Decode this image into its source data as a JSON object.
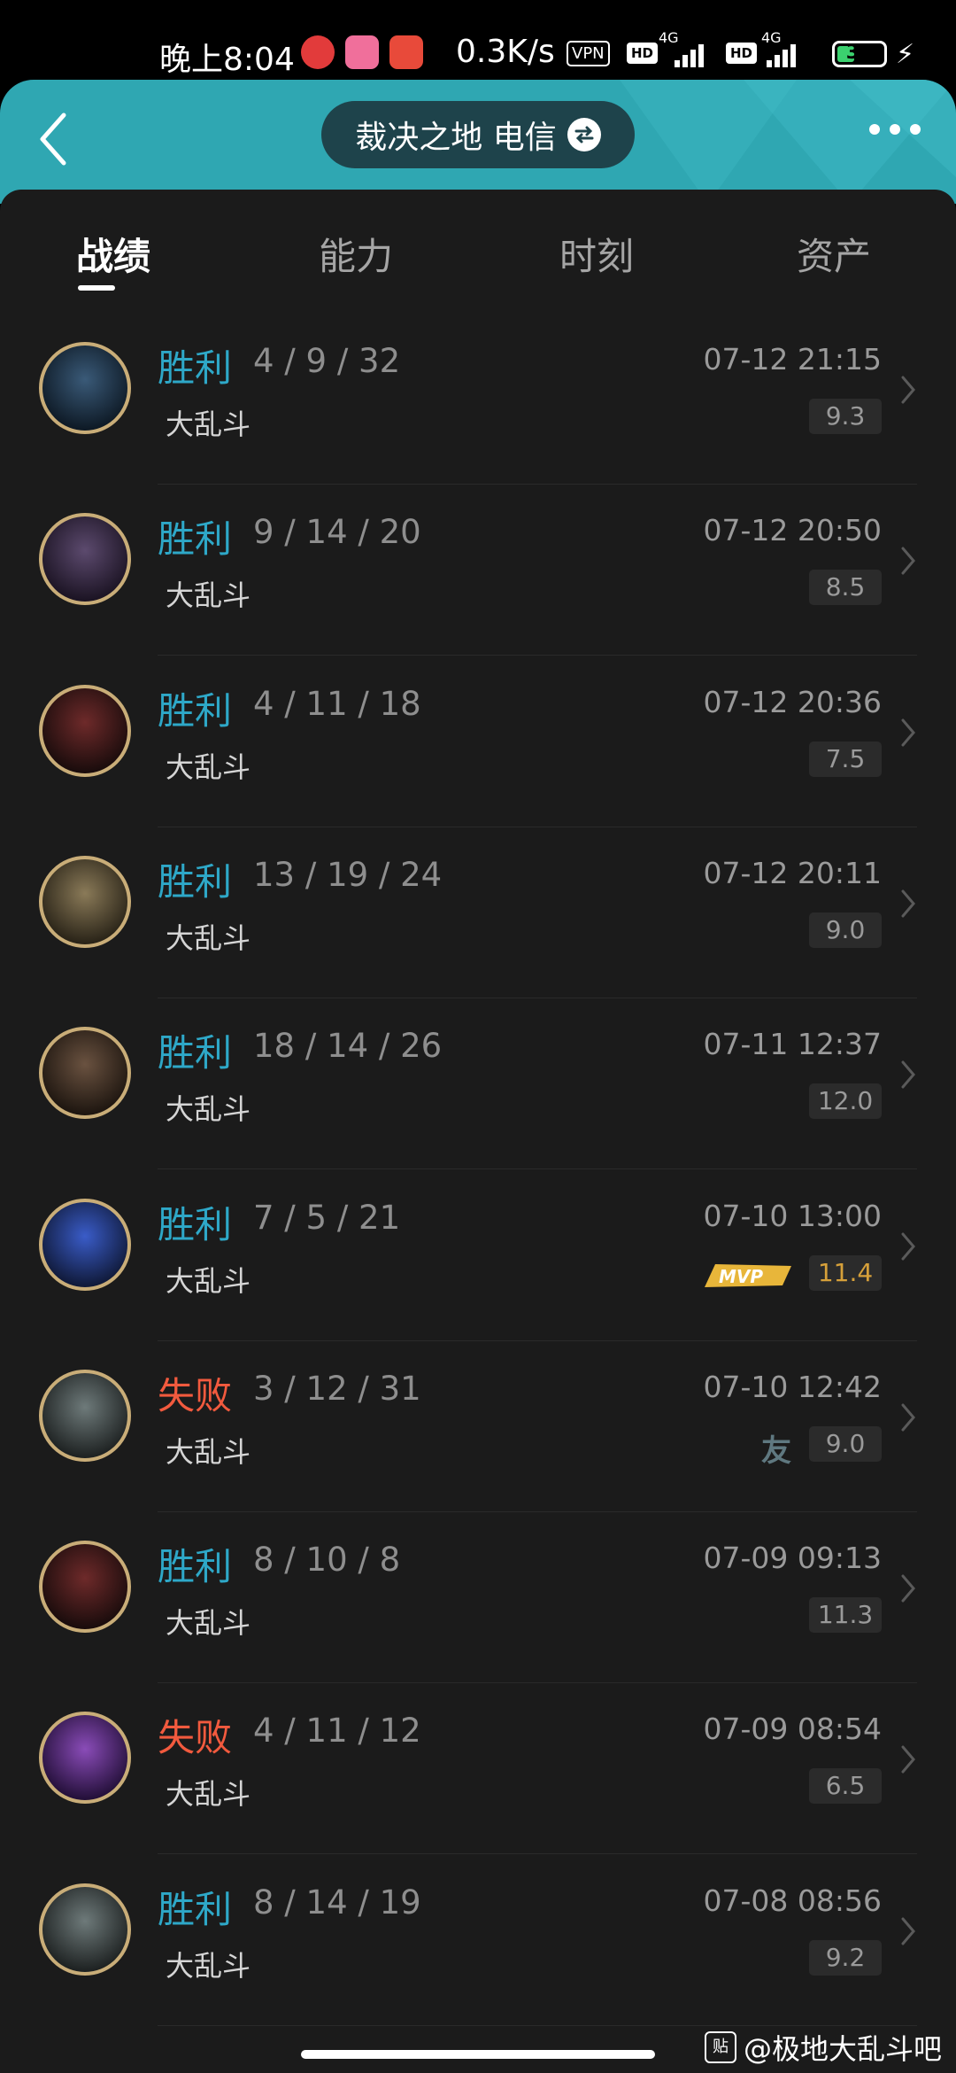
{
  "status_bar": {
    "time": "晚上8:04",
    "network_speed": "0.3K/s",
    "vpn": "VPN",
    "hd1": "HD",
    "hd2": "HD",
    "net1": "4G",
    "net2": "4G",
    "battery": "32"
  },
  "header": {
    "title": "裁决之地 电信",
    "colors": {
      "header_bg": "#2fa7b2",
      "pill_bg": "#1e434b"
    }
  },
  "tabs": [
    {
      "label": "战绩",
      "active": true
    },
    {
      "label": "能力",
      "active": false
    },
    {
      "label": "时刻",
      "active": false
    },
    {
      "label": "资产",
      "active": false
    }
  ],
  "matches": [
    {
      "result": "胜利",
      "win": true,
      "kda": "4 / 9 / 32",
      "mode": "大乱斗",
      "time": "07-12 21:15",
      "score": "9.3"
    },
    {
      "result": "胜利",
      "win": true,
      "kda": "9 / 14 / 20",
      "mode": "大乱斗",
      "time": "07-12 20:50",
      "score": "8.5"
    },
    {
      "result": "胜利",
      "win": true,
      "kda": "4 / 11 / 18",
      "mode": "大乱斗",
      "time": "07-12 20:36",
      "score": "7.5"
    },
    {
      "result": "胜利",
      "win": true,
      "kda": "13 / 19 / 24",
      "mode": "大乱斗",
      "time": "07-12 20:11",
      "score": "9.0"
    },
    {
      "result": "胜利",
      "win": true,
      "kda": "18 / 14 / 26",
      "mode": "大乱斗",
      "time": "07-11 12:37",
      "score": "12.0"
    },
    {
      "result": "胜利",
      "win": true,
      "kda": "7 / 5 / 21",
      "mode": "大乱斗",
      "time": "07-10 13:00",
      "score": "11.4",
      "badge": "MVP"
    },
    {
      "result": "失败",
      "win": false,
      "kda": "3 / 12 / 31",
      "mode": "大乱斗",
      "time": "07-10 12:42",
      "score": "9.0",
      "badge": "友"
    },
    {
      "result": "胜利",
      "win": true,
      "kda": "8 / 10 / 8",
      "mode": "大乱斗",
      "time": "07-09 09:13",
      "score": "11.3"
    },
    {
      "result": "失败",
      "win": false,
      "kda": "4 / 11 / 12",
      "mode": "大乱斗",
      "time": "07-09 08:54",
      "score": "6.5"
    },
    {
      "result": "胜利",
      "win": true,
      "kda": "8 / 14 / 19",
      "mode": "大乱斗",
      "time": "07-08 08:56",
      "score": "9.2"
    }
  ],
  "watermark": "@极地大乱斗吧",
  "watermark_icon": "贴"
}
